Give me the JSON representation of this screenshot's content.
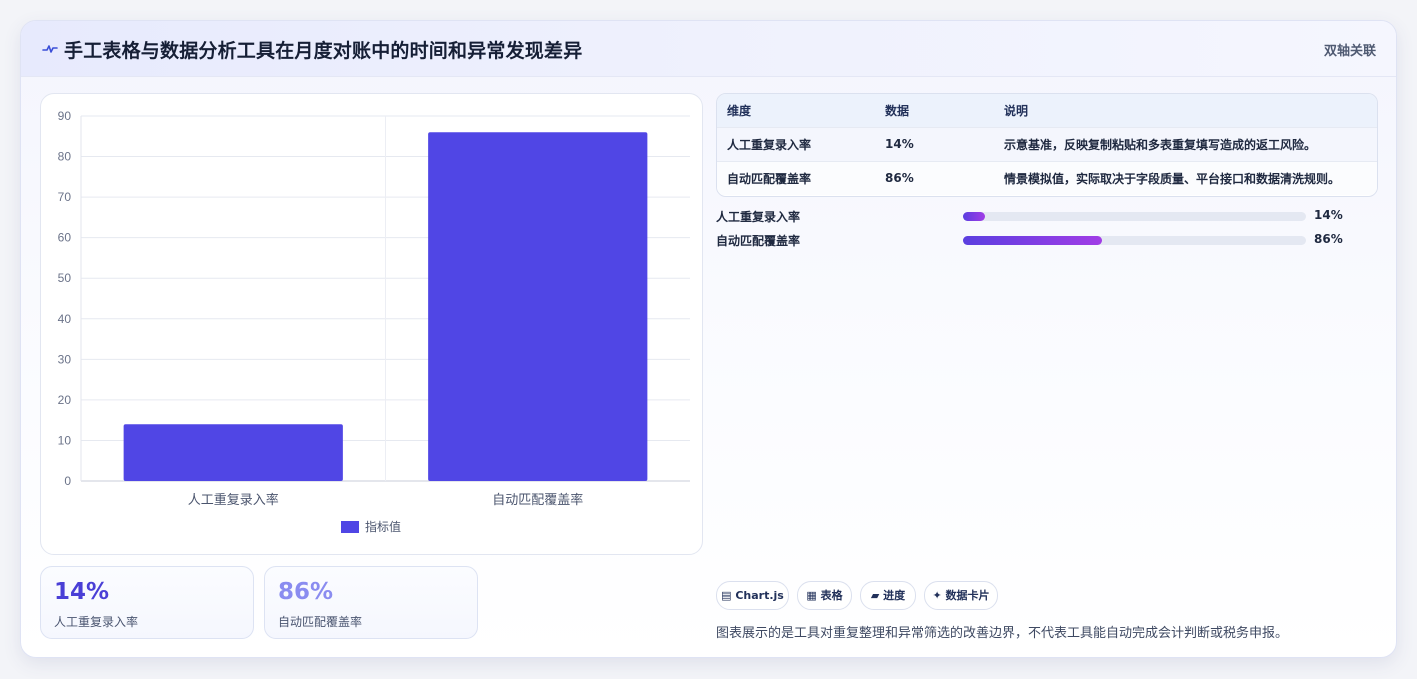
{
  "header": {
    "title": "手工表格与数据分析工具在月度对账中的时间和异常发现差异",
    "tag": "双轴关联"
  },
  "colors": {
    "bar": "#5046e5",
    "stat1": "#4a3fd6",
    "stat2": "#8a8cf0",
    "progress_start": "#5b3fe0",
    "progress_end": "#a13de6"
  },
  "chart_data": {
    "type": "bar",
    "categories": [
      "人工重复录入率",
      "自动匹配覆盖率"
    ],
    "series": [
      {
        "name": "指标值",
        "values": [
          14,
          86
        ]
      }
    ],
    "ylim": [
      0,
      90
    ],
    "yticks": [
      "0",
      "10",
      "20",
      "30",
      "40",
      "50",
      "60",
      "70",
      "80",
      "90"
    ],
    "grid": true,
    "legend": "bottom"
  },
  "stats": [
    {
      "value": "14%",
      "label": "人工重复录入率"
    },
    {
      "value": "86%",
      "label": "自动匹配覆盖率"
    }
  ],
  "table": {
    "headers": [
      "维度",
      "数据",
      "说明"
    ],
    "rows": [
      [
        "人工重复录入率",
        "14%",
        "示意基准，反映复制粘贴和多表重复填写造成的返工风险。"
      ],
      [
        "自动匹配覆盖率",
        "86%",
        "情景模拟值，实际取决于字段质量、平台接口和数据清洗规则。"
      ]
    ]
  },
  "progress": [
    {
      "label": "人工重复录入率",
      "value": "14%",
      "fraction": 0.065
    },
    {
      "label": "自动匹配覆盖率",
      "value": "86%",
      "fraction": 0.405
    }
  ],
  "chips": [
    {
      "icon": "table-icon",
      "label": "▤ Chart.js"
    },
    {
      "icon": "grid-icon",
      "label": "▦ 表格"
    },
    {
      "icon": "bar-icon",
      "label": "▰ 进度"
    },
    {
      "icon": "sparkle-icon",
      "label": "✦ 数据卡片"
    }
  ],
  "note": "图表展示的是工具对重复整理和异常筛选的改善边界，不代表工具能自动完成会计判断或税务申报。"
}
